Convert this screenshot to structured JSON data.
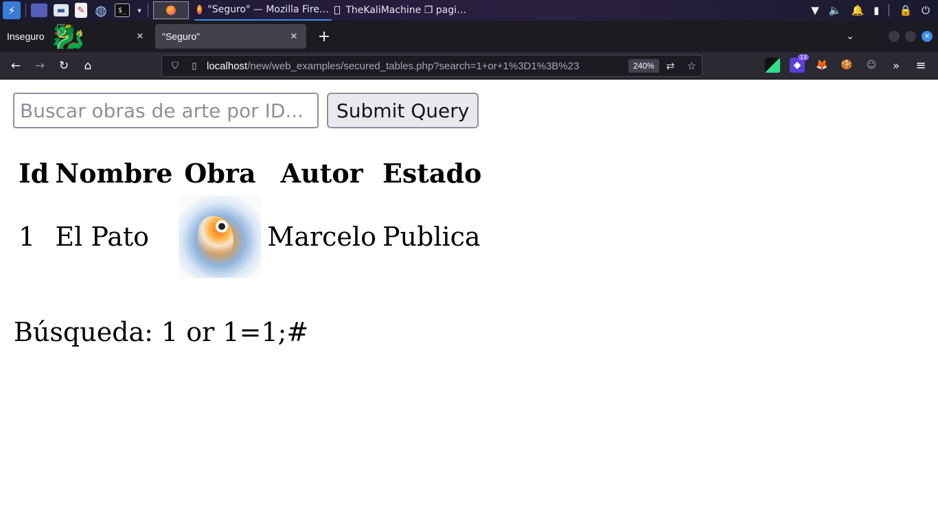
{
  "taskbar": {
    "active_window_title": "\"Seguro\" — Mozilla Fire…",
    "other_window_title": "TheKaliMachine ❐ pagi…",
    "icons": [
      "kali-menu-icon",
      "workspace-icon",
      "file-manager-icon",
      "text-editor-icon",
      "web-browser-icon",
      "terminal-icon",
      "firefox-icon",
      "wifi-icon",
      "volume-icon",
      "bell-icon",
      "battery-icon",
      "lock-icon",
      "power-icon"
    ]
  },
  "browser": {
    "tabs": [
      {
        "label": "Inseguro"
      },
      {
        "label": "\"Seguro\""
      }
    ],
    "url_host": "localhost",
    "url_path": "/new/web_examples/secured_tables.php?search=1+or+1%3D1%3B%23",
    "zoom": "240%",
    "extension_badge": "13"
  },
  "page": {
    "search": {
      "placeholder": "Buscar obras de arte por ID...",
      "value": "",
      "submit_label": "Submit Query"
    },
    "table": {
      "headers": [
        "Id",
        "Nombre",
        "Obra",
        "Autor",
        "Estado"
      ],
      "rows": [
        {
          "id": "1",
          "nombre": "El Pato",
          "obra": "duck watercolor artwork",
          "autor": "Marcelo",
          "estado": "Publica"
        }
      ]
    },
    "search_echo": "Búsqueda: 1 or 1=1;#"
  }
}
